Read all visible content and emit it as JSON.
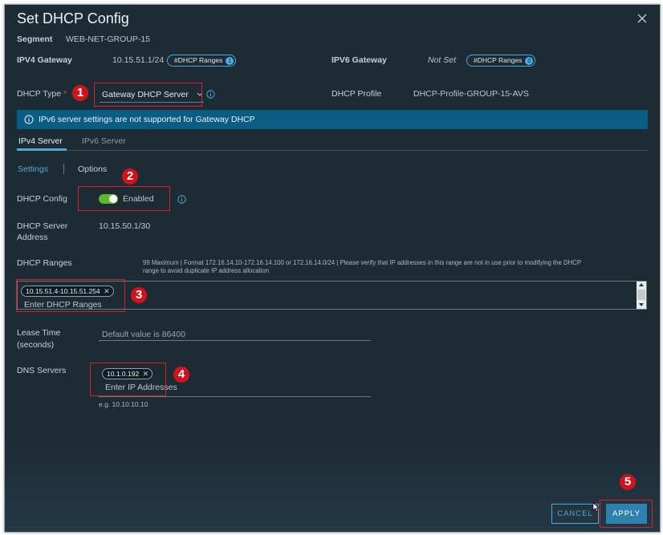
{
  "dialog": {
    "title": "Set DHCP Config",
    "segment_label": "Segment",
    "segment_value": "WEB-NET-GROUP-15"
  },
  "ipv4_gateway": {
    "label": "IPV4 Gateway",
    "value": "10.15.51.1/24",
    "ranges_pill": "#DHCP Ranges",
    "ranges_count": "1"
  },
  "ipv6_gateway": {
    "label": "IPV6 Gateway",
    "value": "Not Set",
    "ranges_pill": "#DHCP Ranges",
    "ranges_count": "0"
  },
  "dhcp_type": {
    "label": "DHCP Type",
    "required_mark": "*",
    "value": "Gateway DHCP Server"
  },
  "dhcp_profile": {
    "label": "DHCP Profile",
    "value": "DHCP-Profile-GROUP-15-AVS"
  },
  "banner": {
    "text": "IPv6 server settings are not supported for Gateway DHCP"
  },
  "tabs": [
    {
      "label": "IPv4 Server",
      "active": true
    },
    {
      "label": "IPv6 Server",
      "active": false
    }
  ],
  "subtabs": [
    {
      "label": "Settings",
      "active": true
    },
    {
      "label": "Options",
      "active": false
    }
  ],
  "dhcp_config": {
    "label": "DHCP Config",
    "toggle_label": "Enabled",
    "enabled": true
  },
  "server_address": {
    "label_line1": "DHCP Server",
    "label_line2": "Address",
    "value": "10.15.50.1/30"
  },
  "dhcp_ranges": {
    "label": "DHCP Ranges",
    "hint_line1": "99 Maximum | Format 172.16.14.10-172.16.14.100 or 172.16.14.0/24 | Please verify that IP addresses in this range are not in use prior to modifying the DHCP",
    "hint_line2": "range to avoid duplicate IP address allocation",
    "chip": "10.15.51.4-10.15.51.254",
    "placeholder": "Enter DHCP Ranges"
  },
  "lease_time": {
    "label_line1": "Lease Time",
    "label_line2": "(seconds)",
    "placeholder": "Default value is 86400"
  },
  "dns_servers": {
    "label": "DNS Servers",
    "chip": "10.1.0.192",
    "placeholder": "Enter IP Addresses",
    "example": "e.g. 10.10.10.10"
  },
  "buttons": {
    "cancel": "CANCEL",
    "apply": "APPLY"
  },
  "callouts": [
    "1",
    "2",
    "3",
    "4",
    "5"
  ],
  "colors": {
    "background": "#1d2b35",
    "accent": "#4fa8d6",
    "banner": "#0b5c83",
    "toggle_on": "#5cb82e",
    "callout": "#d0121b"
  }
}
